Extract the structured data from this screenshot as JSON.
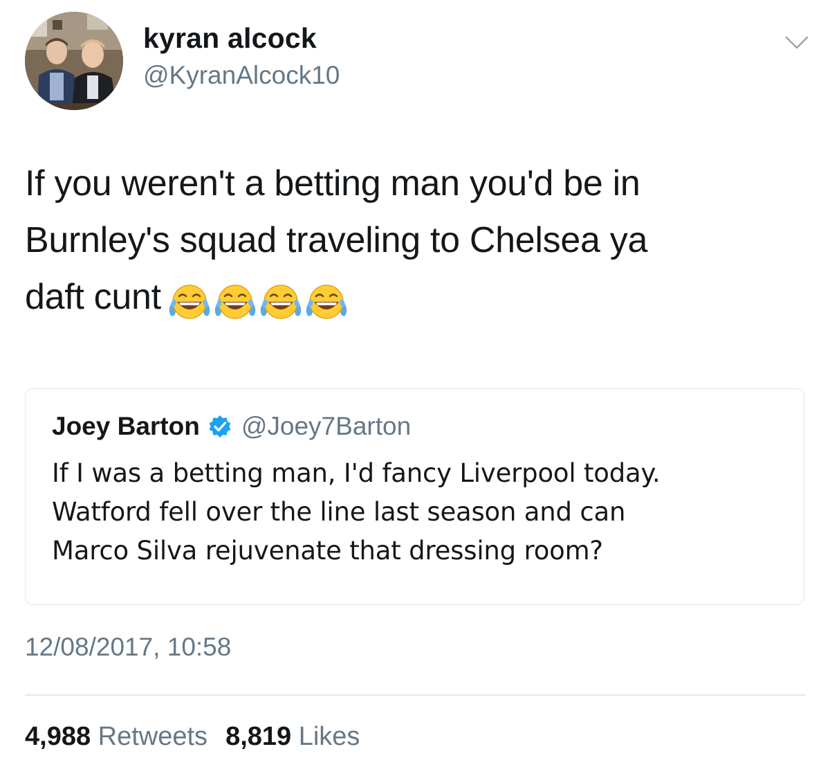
{
  "tweet": {
    "author": {
      "display_name": "kyran alcock",
      "handle": "@KyranAlcock10",
      "avatar_icon": "profile-photo"
    },
    "menu_icon": "chevron-down-icon",
    "text_lines": [
      "If you weren't a betting man you'd be in",
      "Burnley's squad traveling to Chelsea ya",
      "daft cunt"
    ],
    "emojis": [
      "face-with-tears-of-joy",
      "face-with-tears-of-joy",
      "face-with-tears-of-joy",
      "face-with-tears-of-joy"
    ],
    "quoted": {
      "display_name": "Joey Barton",
      "verified": true,
      "handle": "@Joey7Barton",
      "text_lines": [
        "If I was a betting man, I'd fancy Liverpool today.",
        "Watford fell over the line last season and can",
        "Marco Silva rejuvenate that dressing room?"
      ]
    },
    "timestamp": "12/08/2017, 10:58",
    "stats": {
      "retweets_count": "4,988",
      "retweets_label": "Retweets",
      "likes_count": "8,819",
      "likes_label": "Likes"
    }
  },
  "colors": {
    "primary_text": "#14171a",
    "secondary_text": "#657786",
    "border": "#e1e8ed",
    "verified_blue": "#1da1f2",
    "emoji_yellow": "#ffcc33"
  }
}
